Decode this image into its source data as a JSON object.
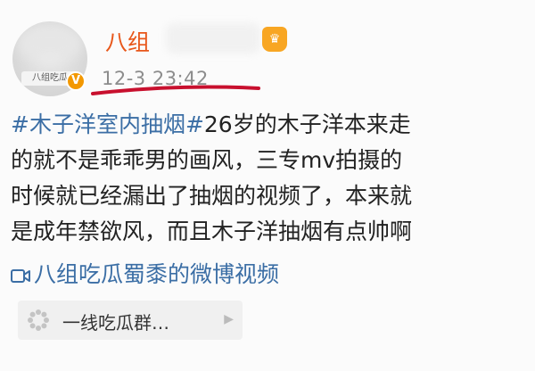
{
  "header": {
    "username": "八组",
    "timestamp": "12-3 23:42",
    "avatar_tag": "八组吃瓜",
    "vip_mark": "V"
  },
  "post": {
    "hashtag": "#木子洋室内抽烟#",
    "line1_rest": "26岁的木子洋本来走",
    "line2": "的就不是乖乖男的画风，三专mv拍摄的",
    "line3": "时候就已经漏出了抽烟的视频了，本来就",
    "line4": "是成年禁欲风，而且木子洋抽烟有点帅啊"
  },
  "video_link": {
    "label": "八组吃瓜蜀黍的微博视频"
  },
  "group_card": {
    "name": "一线吃瓜群…"
  },
  "colors": {
    "username": "#e8571a",
    "link": "#3b6ea5",
    "annotation_underline": "#c8102e",
    "vip_badge": "#f39800"
  }
}
